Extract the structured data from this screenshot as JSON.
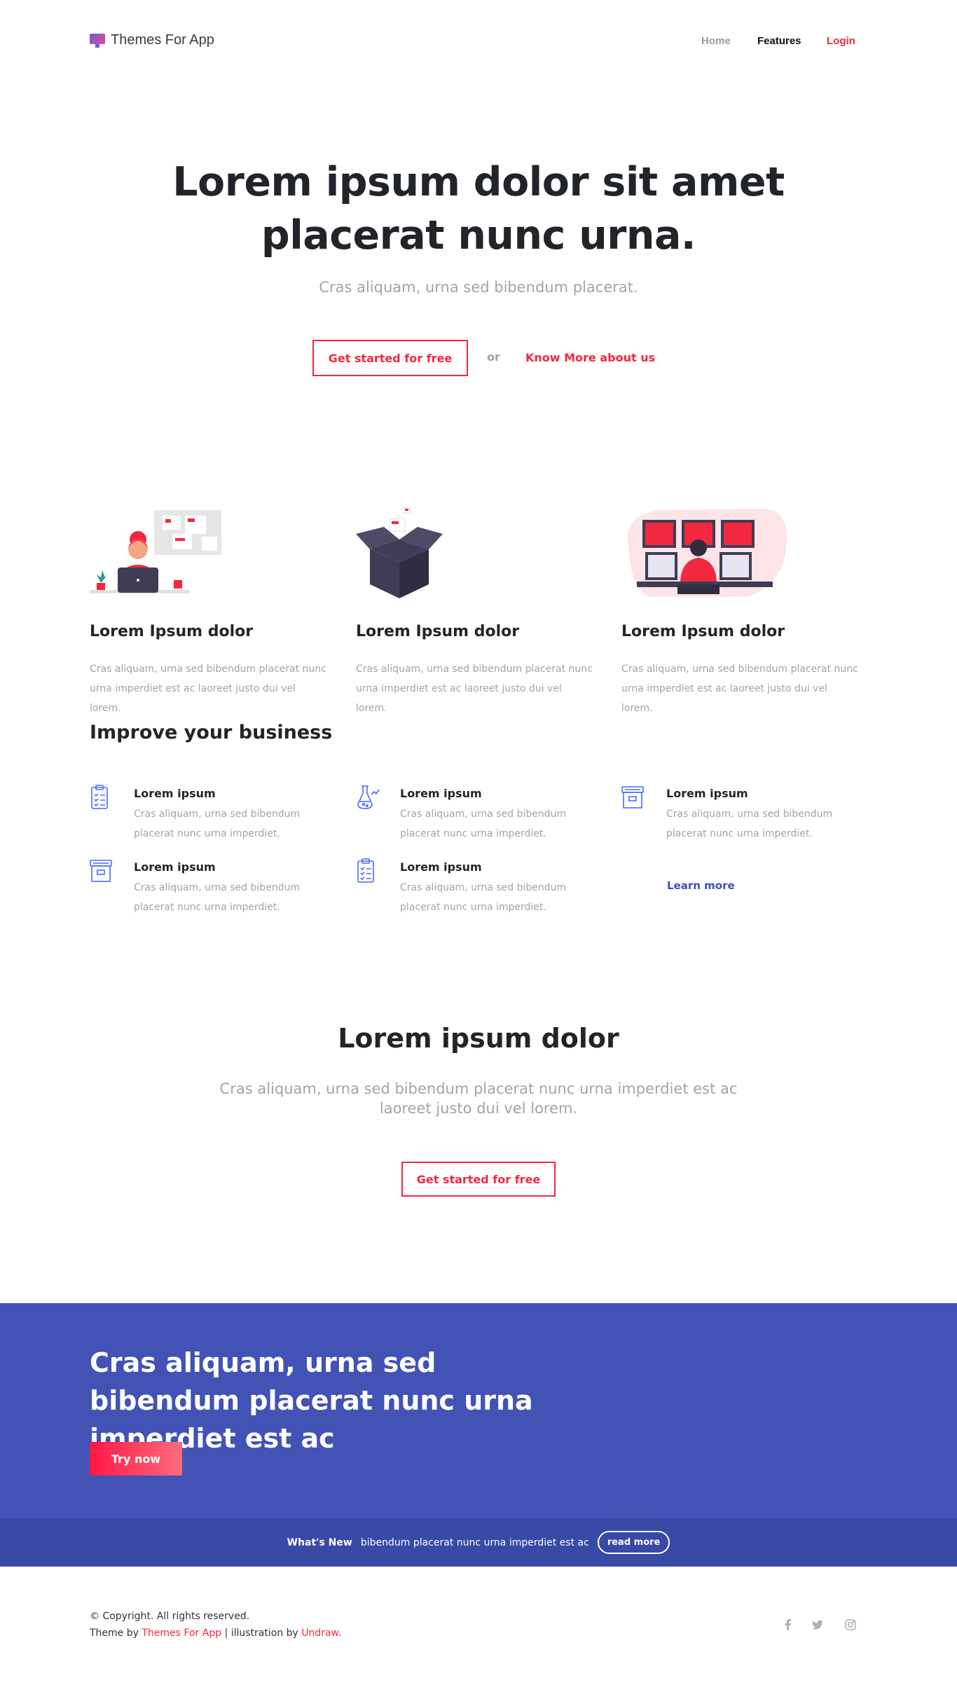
{
  "nav": {
    "logo_text": "Themes For App",
    "home": "Home",
    "features": "Features",
    "login": "Login"
  },
  "hero": {
    "title": "Lorem ipsum dolor sit amet placerat nunc urna.",
    "subtitle": "Cras aliquam, urna sed bibendum placerat.",
    "primary_button": "Get started for free",
    "or_text": "or",
    "secondary_link": "Know More about us"
  },
  "cards": [
    {
      "title": "Lorem Ipsum dolor",
      "text": "Cras aliquam, urna sed bibendum placerat nunc urna imperdiet est ac laoreet justo dui vel lorem.",
      "illustration": "woman-at-laptop-illustration"
    },
    {
      "title": "Lorem Ipsum dolor",
      "text": "Cras aliquam, urna sed bibendum placerat nunc urna imperdiet est ac laoreet justo dui vel lorem.",
      "illustration": "open-box-illustration"
    },
    {
      "title": "Lorem Ipsum dolor",
      "text": "Cras aliquam, urna sed bibendum placerat nunc urna imperdiet est ac laoreet justo dui vel lorem.",
      "illustration": "monitors-workstation-illustration"
    }
  ],
  "improve": {
    "title": "Improve your business",
    "items": [
      {
        "title": "Lorem ipsum",
        "text": "Cras aliquam, urna sed bibendum placerat nunc urna imperdiet.",
        "icon": "clipboard-icon"
      },
      {
        "title": "Lorem ipsum",
        "text": "Cras aliquam, urna sed bibendum placerat nunc urna imperdiet.",
        "icon": "flask-icon"
      },
      {
        "title": "Lorem ipsum",
        "text": "Cras aliquam, urna sed bibendum placerat nunc urna imperdiet.",
        "icon": "archive-box-icon"
      },
      {
        "title": "Lorem ipsum",
        "text": "Cras aliquam, urna sed bibendum placerat nunc urna imperdiet.",
        "icon": "archive-box-icon"
      },
      {
        "title": "Lorem ipsum",
        "text": "Cras aliquam, urna sed bibendum placerat nunc urna imperdiet.",
        "icon": "clipboard-icon"
      }
    ],
    "learn_more": "Learn more"
  },
  "cta": {
    "title": "Lorem ipsum dolor",
    "text": "Cras aliquam, urna sed bibendum placerat nunc urna imperdiet est ac laoreet justo dui vel lorem.",
    "button": "Get started for free"
  },
  "banner": {
    "title": "Cras aliquam, urna sed bibendum placerat nunc urna imperdiet est ac",
    "button": "Try now"
  },
  "news": {
    "label": "What's New",
    "text": "bibendum placerat nunc urna imperdiet est ac",
    "button": "read more"
  },
  "footer": {
    "copyright": "© Copyright. All rights reserved.",
    "theme_by": "Theme by",
    "theme_link": "Themes For App",
    "separator": " | illustration by",
    "illus_link": "Undraw",
    "period": ".",
    "social": [
      "facebook-icon",
      "twitter-icon",
      "instagram-icon"
    ]
  },
  "colors": {
    "accent": "#f2283f",
    "banner_blue": "#4252b5",
    "newsbar_blue": "#3849a6",
    "muted_text": "#a3a3a3",
    "icon_blue": "#4a6cf7"
  }
}
